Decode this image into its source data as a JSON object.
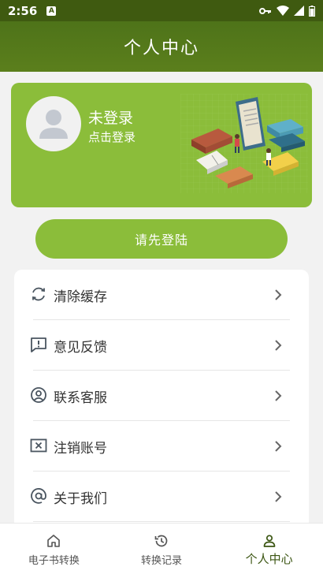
{
  "status_bar": {
    "time": "2:56",
    "a_badge": "A"
  },
  "header": {
    "title": "个人中心"
  },
  "profile": {
    "name": "未登录",
    "login_prompt": "点击登录"
  },
  "login_button": {
    "label": "请先登陆"
  },
  "menu": {
    "items": [
      {
        "label": "清除缓存",
        "icon": "refresh-icon"
      },
      {
        "label": "意见反馈",
        "icon": "feedback-icon"
      },
      {
        "label": "联系客服",
        "icon": "customer-service-icon"
      },
      {
        "label": "注销账号",
        "icon": "close-account-icon"
      },
      {
        "label": "关于我们",
        "icon": "at-icon"
      }
    ]
  },
  "bottom_nav": {
    "tabs": [
      {
        "label": "电子书转换",
        "icon": "home-icon",
        "active": false
      },
      {
        "label": "转换记录",
        "icon": "history-icon",
        "active": false
      },
      {
        "label": "个人中心",
        "icon": "user-icon",
        "active": true
      }
    ]
  },
  "colors": {
    "header": "#4e7319",
    "accent": "#8bbd3a",
    "active_tab": "#3c5613"
  }
}
